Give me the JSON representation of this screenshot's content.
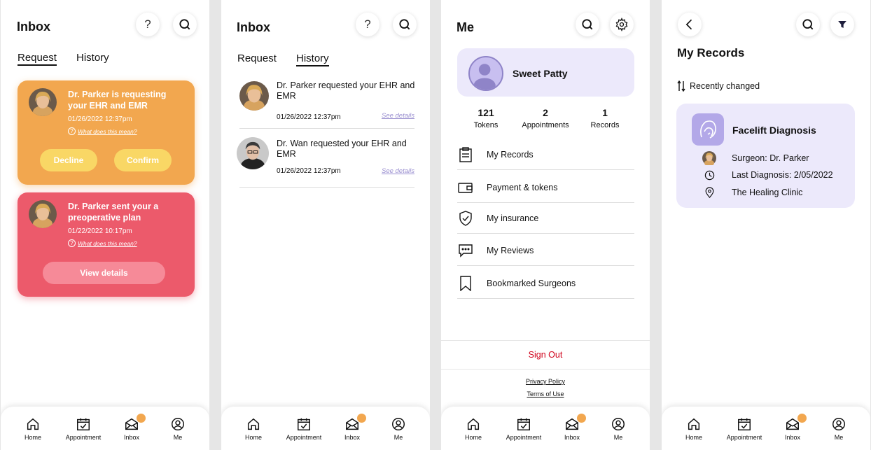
{
  "nav": {
    "items": [
      "Home",
      "Appointment",
      "Inbox",
      "Me"
    ]
  },
  "inbox": {
    "title": "Inbox",
    "tabs": {
      "request": "Request",
      "history": "History"
    },
    "requests": [
      {
        "title": "Dr. Parker is requesting your EHR and EMR",
        "time": "01/26/2022 12:37pm",
        "help": "What does this mean?",
        "decline": "Decline",
        "confirm": "Confirm"
      },
      {
        "title": "Dr. Parker sent your a preoperative plan",
        "time": "01/22/2022 10:17pm",
        "help": "What does this mean?",
        "action": "View details"
      }
    ],
    "history": [
      {
        "text": "Dr. Parker requested your EHR and EMR",
        "time": "01/26/2022 12:37pm",
        "link": "See details"
      },
      {
        "text": "Dr. Wan requested your EHR and EMR",
        "time": "01/26/2022 12:37pm",
        "link": "See details"
      }
    ]
  },
  "me": {
    "title": "Me",
    "name": "Sweet Patty",
    "stats": [
      {
        "value": "121",
        "label": "Tokens"
      },
      {
        "value": "2",
        "label": "Appointments"
      },
      {
        "value": "1",
        "label": "Records"
      }
    ],
    "menu": [
      "My Records",
      "Payment & tokens",
      "My insurance",
      "My Reviews",
      "Bookmarked Surgeons"
    ],
    "signout": "Sign Out",
    "privacy": "Privacy Policy",
    "terms": "Terms of Use"
  },
  "records": {
    "title": "My Records",
    "sort": "Recently changed",
    "card": {
      "title": "Facelift Diagnosis",
      "surgeon": "Surgeon: Dr. Parker",
      "last": "Last Diagnosis: 2/05/2022",
      "clinic": "The Healing Clinic"
    }
  },
  "colors": {
    "orange": "#f2a74f",
    "red": "#ec5a6b",
    "lavender": "#ece9fb",
    "signout": "#d0021b"
  }
}
